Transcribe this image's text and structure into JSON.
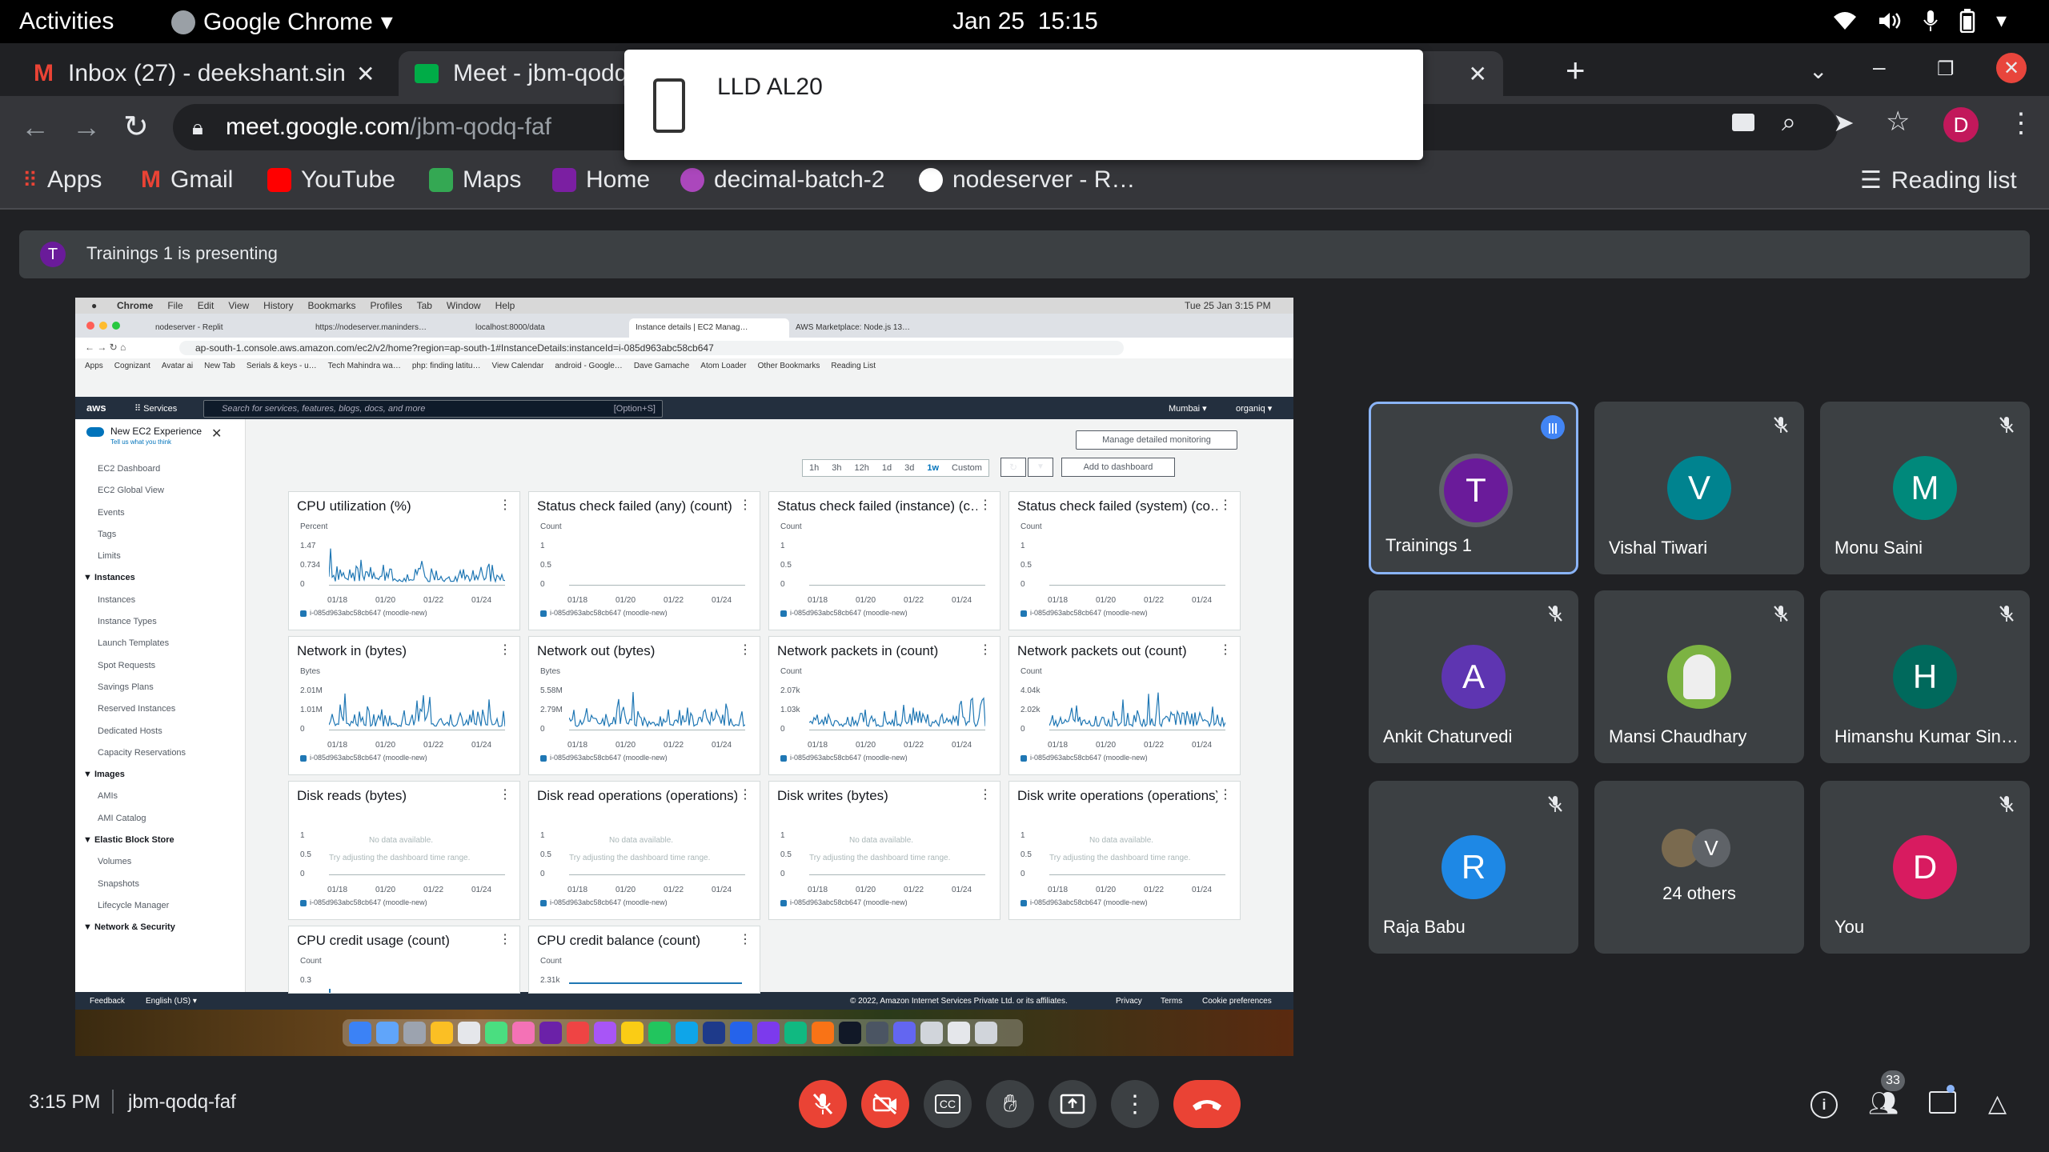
{
  "os": {
    "activities": "Activities",
    "app": "Google Chrome",
    "date": "Jan 25",
    "time": "15:15"
  },
  "tabs": [
    {
      "title": "Inbox (27) - deekshant.sin"
    },
    {
      "title": "Meet - jbm-qodq"
    }
  ],
  "popup": {
    "device": "LLD AL20"
  },
  "address": {
    "host": "meet.google.com",
    "path": "/jbm-qodq-faf",
    "avatar": "D"
  },
  "bookmarks": [
    "Apps",
    "Gmail",
    "YouTube",
    "Maps",
    "Home",
    "decimal-batch-2",
    "nodeserver - R…"
  ],
  "reading_list": "Reading list",
  "presenting": {
    "initial": "T",
    "text": "Trainings 1 is presenting"
  },
  "shared": {
    "mac_menu": [
      "Chrome",
      "File",
      "Edit",
      "View",
      "History",
      "Bookmarks",
      "Profiles",
      "Tab",
      "Window",
      "Help"
    ],
    "mac_clock": "Tue 25 Jan  3:15 PM",
    "inner_tabs": [
      "nodeserver - Replit",
      "https://nodeserver.maninders…",
      "localhost:8000/data",
      "Instance details | EC2 Manag…",
      "AWS Marketplace: Node.js 13…"
    ],
    "inner_url": "ap-south-1.console.aws.amazon.com/ec2/v2/home?region=ap-south-1#InstanceDetails:instanceId=i-085d963abc58cb647",
    "inner_bookmarks": [
      "Apps",
      "Cognizant",
      "Avatar ai",
      "New Tab",
      "Serials & keys - u…",
      "Tech Mahindra wa…",
      "php: finding latitu…",
      "View Calendar",
      "android - Google…",
      "Dave Gamache",
      "Atom Loader",
      "Other Bookmarks",
      "Reading List"
    ],
    "aws_search": "Search for services, features, blogs, docs, and more",
    "aws_shortcut": "[Option+S]",
    "aws_services": "Services",
    "aws_region": "Mumbai ▾",
    "aws_account": "organiq ▾",
    "new_exp": "New EC2 Experience",
    "new_exp_sub": "Tell us what you think",
    "sidebar": [
      "EC2 Dashboard",
      "EC2 Global View",
      "Events",
      "Tags",
      "Limits",
      "▼ Instances",
      "Instances",
      "Instance Types",
      "Launch Templates",
      "Spot Requests",
      "Savings Plans",
      "Reserved Instances",
      "Dedicated Hosts",
      "Capacity Reservations",
      "▼ Images",
      "AMIs",
      "AMI Catalog",
      "▼ Elastic Block Store",
      "Volumes",
      "Snapshots",
      "Lifecycle Manager",
      "▼ Network & Security"
    ],
    "manage_btn": "Manage detailed monitoring",
    "ranges": [
      "1h",
      "3h",
      "12h",
      "1d",
      "3d",
      "1w",
      "Custom"
    ],
    "add_dash": "Add to dashboard",
    "legend": "i-085d963abc58cb647 (moodle-new)",
    "xticks": [
      "01/18",
      "01/20",
      "01/22",
      "01/24"
    ],
    "nodata": "No data available.",
    "nodata_hint": "Try adjusting the dashboard time range.",
    "panels": [
      {
        "title": "CPU utilization (%)",
        "unit": "Percent",
        "y": [
          "1.47",
          "0.734",
          "0"
        ],
        "kind": "line"
      },
      {
        "title": "Status check failed (any) (count)",
        "unit": "Count",
        "y": [
          "1",
          "0.5",
          "0"
        ],
        "kind": "flat"
      },
      {
        "title": "Status check failed (instance) (c…",
        "unit": "Count",
        "y": [
          "1",
          "0.5",
          "0"
        ],
        "kind": "flat"
      },
      {
        "title": "Status check failed (system) (co…",
        "unit": "Count",
        "y": [
          "1",
          "0.5",
          "0"
        ],
        "kind": "flat"
      },
      {
        "title": "Network in (bytes)",
        "unit": "Bytes",
        "y": [
          "2.01M",
          "1.01M",
          "0"
        ],
        "kind": "line"
      },
      {
        "title": "Network out (bytes)",
        "unit": "Bytes",
        "y": [
          "5.58M",
          "2.79M",
          "0"
        ],
        "kind": "line"
      },
      {
        "title": "Network packets in (count)",
        "unit": "Count",
        "y": [
          "2.07k",
          "1.03k",
          "0"
        ],
        "kind": "line"
      },
      {
        "title": "Network packets out (count)",
        "unit": "Count",
        "y": [
          "4.04k",
          "2.02k",
          "0"
        ],
        "kind": "line"
      },
      {
        "title": "Disk reads (bytes)",
        "unit": "",
        "y": [
          "1",
          "0.5",
          "0"
        ],
        "kind": "nodata"
      },
      {
        "title": "Disk read operations (operations)",
        "unit": "",
        "y": [
          "1",
          "0.5",
          "0"
        ],
        "kind": "nodata"
      },
      {
        "title": "Disk writes (bytes)",
        "unit": "",
        "y": [
          "1",
          "0.5",
          "0"
        ],
        "kind": "nodata"
      },
      {
        "title": "Disk write operations (operations)",
        "unit": "",
        "y": [
          "1",
          "0.5",
          "0"
        ],
        "kind": "nodata"
      },
      {
        "title": "CPU credit usage (count)",
        "unit": "Count",
        "y": [
          "0.3"
        ],
        "kind": "partial"
      },
      {
        "title": "CPU credit balance (count)",
        "unit": "Count",
        "y": [
          "2.31k"
        ],
        "kind": "partial"
      }
    ],
    "footer": {
      "feedback": "Feedback",
      "lang": "English (US) ▾",
      "copy": "© 2022, Amazon Internet Services Private Ltd. or its affiliates.",
      "privacy": "Privacy",
      "terms": "Terms",
      "cookies": "Cookie preferences"
    }
  },
  "participants": [
    {
      "name": "Trainings 1",
      "initial": "T",
      "color": "#6a1b9a",
      "speaking": true
    },
    {
      "name": "Vishal Tiwari",
      "initial": "V",
      "color": "#00838f",
      "muted": true
    },
    {
      "name": "Monu Saini",
      "initial": "M",
      "color": "#00897b",
      "muted": true
    },
    {
      "name": "Ankit Chaturvedi",
      "initial": "A",
      "color": "#5e35b1",
      "muted": true
    },
    {
      "name": "Mansi Chaudhary",
      "initial": "",
      "color": "#7cb342",
      "muted": true
    },
    {
      "name": "Himanshu Kumar Sin…",
      "initial": "H",
      "color": "#00695c",
      "muted": true
    },
    {
      "name": "Raja Babu",
      "initial": "R",
      "color": "#1e88e5",
      "muted": true
    },
    {
      "name": "24 others",
      "initial": "V",
      "color": "#5f6368"
    },
    {
      "name": "You",
      "initial": "D",
      "color": "#d81b60",
      "muted": true
    }
  ],
  "bottom": {
    "time": "3:15 PM",
    "code": "jbm-qodq-faf",
    "people_count": "33"
  }
}
